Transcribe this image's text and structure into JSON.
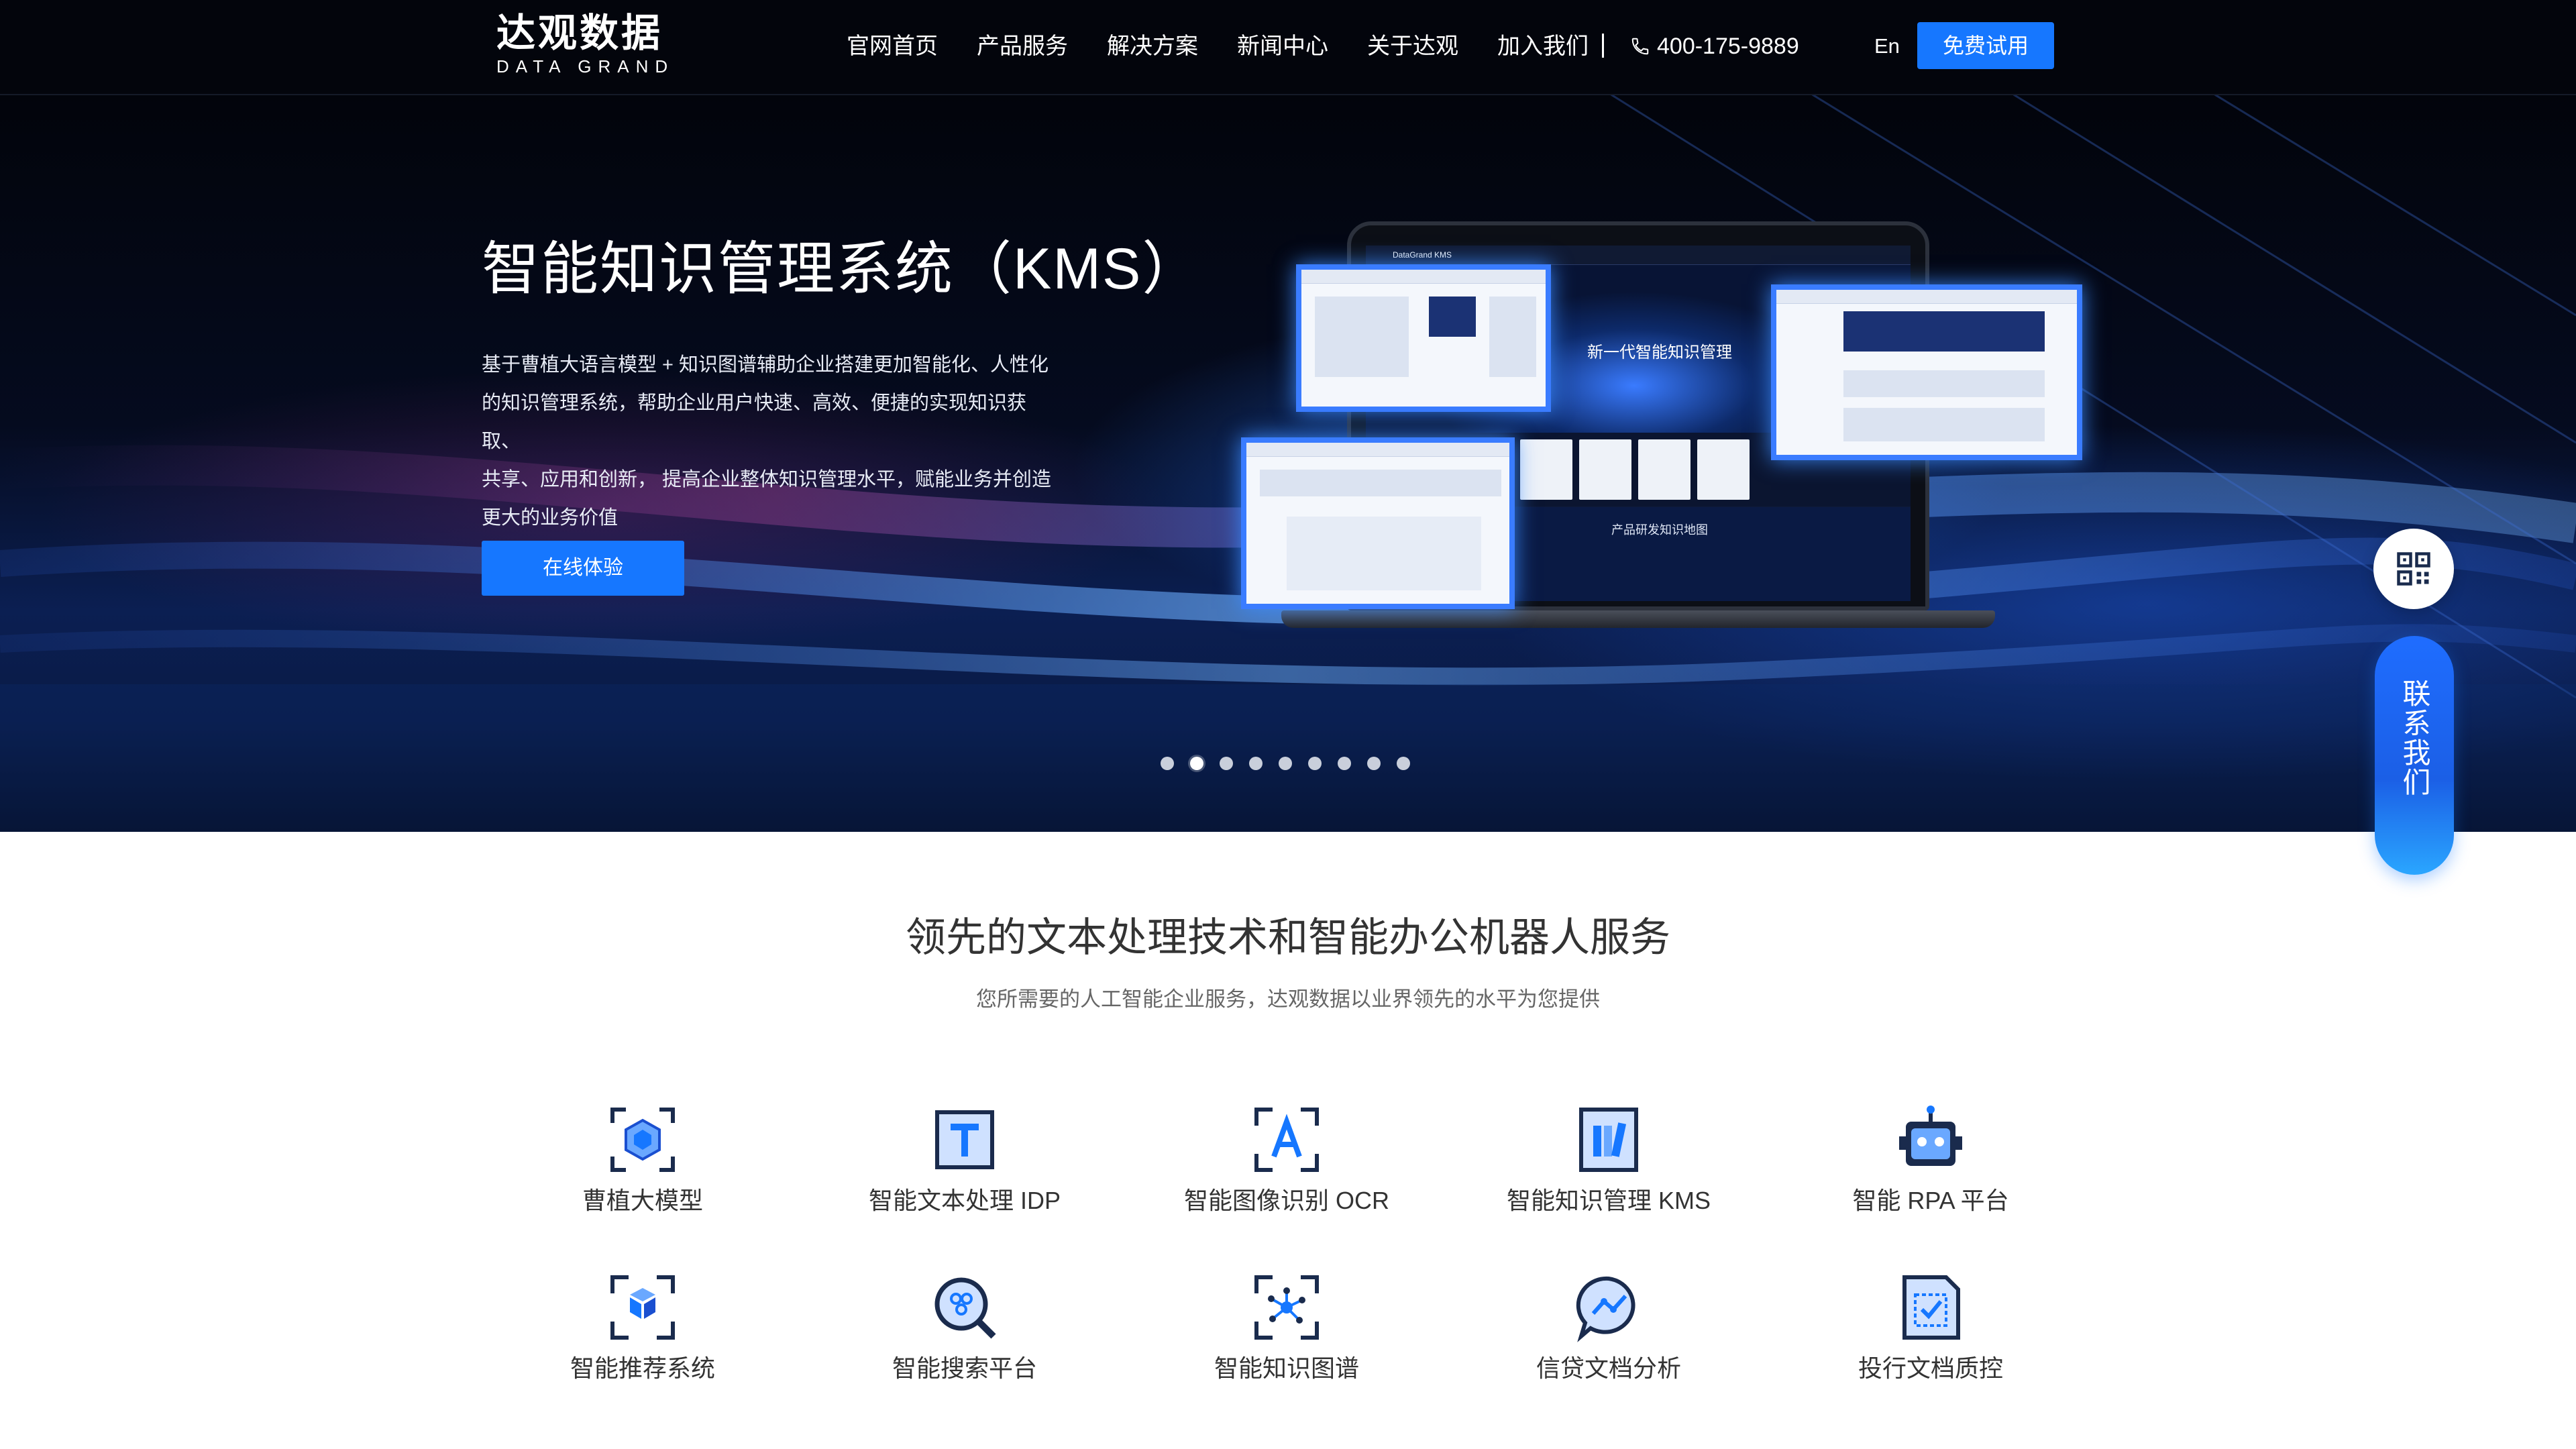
{
  "header": {
    "logo_cn": "达观数据",
    "logo_en": "DATA GRAND",
    "nav": [
      "官网首页",
      "产品服务",
      "解决方案",
      "新闻中心",
      "关于达观",
      "加入我们"
    ],
    "phone": "400-175-9889",
    "lang": "En",
    "trial_label": "免费试用"
  },
  "hero": {
    "title": "智能知识管理系统（KMS）",
    "desc_lines": [
      "基于曹植大语言模型 + 知识图谱辅助企业搭建更加智能化、人性化",
      "的知识管理系统，帮助企业用户快速、高效、便捷的实现知识获取、",
      "共享、应用和创新， 提高企业整体知识管理水平，赋能业务并创造",
      "更大的业务价值"
    ],
    "button_label": "在线体验",
    "slides_count": 9,
    "active_slide": 2,
    "mock": {
      "brand": "DataGrand KMS",
      "banner_text": "新一代智能知识管理",
      "footer_text": "产品研发知识地图"
    }
  },
  "side": {
    "qr_icon": "qr-code-icon",
    "contact_label": "联系我们"
  },
  "services": {
    "title": "领先的文本处理技术和智能办公机器人服务",
    "subtitle": "您所需要的人工智能企业服务，达观数据以业界领先的水平为您提供",
    "items": [
      {
        "label": "曹植大模型",
        "icon": "large-model-icon"
      },
      {
        "label": "智能文本处理 IDP",
        "icon": "text-processing-icon"
      },
      {
        "label": "智能图像识别 OCR",
        "icon": "ocr-icon"
      },
      {
        "label": "智能知识管理 KMS",
        "icon": "knowledge-management-icon"
      },
      {
        "label": "智能 RPA 平台",
        "icon": "robot-icon"
      },
      {
        "label": "智能推荐系统",
        "icon": "recommendation-icon"
      },
      {
        "label": "智能搜索平台",
        "icon": "search-icon"
      },
      {
        "label": "智能知识图谱",
        "icon": "knowledge-graph-icon"
      },
      {
        "label": "信贷文档分析",
        "icon": "credit-analysis-icon"
      },
      {
        "label": "投行文档质控",
        "icon": "document-qc-icon"
      }
    ]
  },
  "colors": {
    "accent": "#1677ff",
    "icon_dark": "#1a2b4d",
    "hero_dark": "#03050c"
  }
}
